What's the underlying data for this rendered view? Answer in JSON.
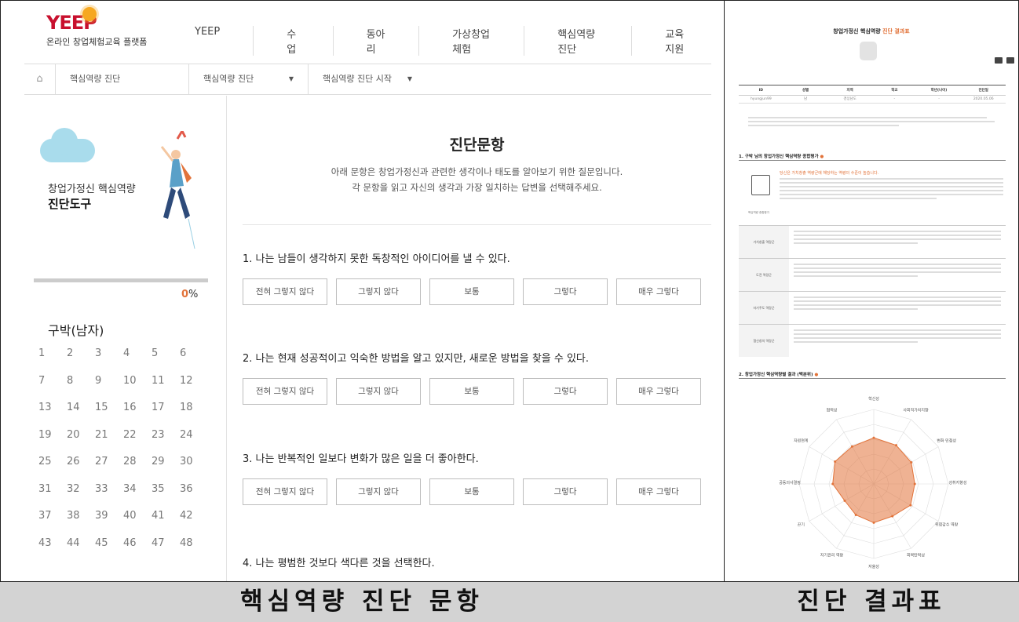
{
  "left": {
    "logo": {
      "word": "YEEP",
      "subtitle": "온라인 창업체험교육 플랫폼"
    },
    "nav": [
      "YEEP",
      "수업",
      "동아리",
      "가상창업체험",
      "핵심역량 진단",
      "교육지원"
    ],
    "subnav": {
      "home_icon": "home-icon",
      "items": [
        "핵심역량 진단",
        "핵심역량 진단",
        "핵심역량 진단 시작"
      ],
      "dropdown_glyph": "▼"
    },
    "sidebar": {
      "title_line1": "창업가정신 핵심역량",
      "title_line2": "진단도구",
      "progress_value": "0",
      "progress_unit": "%",
      "progress_fraction": 0,
      "stage": "구박(남자)",
      "numbers": [
        "1",
        "2",
        "3",
        "4",
        "5",
        "6",
        "7",
        "8",
        "9",
        "10",
        "11",
        "12",
        "13",
        "14",
        "15",
        "16",
        "17",
        "18",
        "19",
        "20",
        "21",
        "22",
        "23",
        "24",
        "25",
        "26",
        "27",
        "28",
        "29",
        "30",
        "31",
        "32",
        "33",
        "34",
        "35",
        "36",
        "37",
        "38",
        "39",
        "40",
        "41",
        "42",
        "43",
        "44",
        "45",
        "46",
        "47",
        "48"
      ]
    },
    "content": {
      "title": "진단문항",
      "desc_line1": "아래 문항은 창업가정신과 관련한 생각이나 태도를 알아보기 위한 질문입니다.",
      "desc_line2": "각 문항을 읽고 자신의 생각과 가장 일치하는 답변을 선택해주세요.",
      "options": [
        "전혀 그렇지 않다",
        "그렇지 않다",
        "보통",
        "그렇다",
        "매우 그렇다"
      ],
      "questions": [
        "1.   나는 남들이 생각하지 못한 독창적인 아이디어를 낼 수 있다.",
        "2.   나는 현재 성공적이고 익숙한 방법을 알고 있지만, 새로운 방법을 찾을 수 있다.",
        "3.   나는 반복적인 일보다 변화가 많은 일을 더 좋아한다.",
        "4.   나는 평범한 것보다 색다른 것을 선택한다."
      ]
    }
  },
  "right": {
    "title_prefix": "창업가정신 핵심역량",
    "title_accent": "진단 결과표",
    "table": {
      "headers": [
        "ID",
        "성별",
        "지역",
        "학교",
        "학년(나이)",
        "진단일"
      ],
      "row": [
        "hyungjun99",
        "남",
        "경상남도",
        "-",
        "-",
        "2020.05.06"
      ]
    },
    "section1_title": "1. 구박 님의 창업가정신 핵심역량 종합평가",
    "summary_headline": "당신은 가치창출 역량군에 해당하는 역량의 수준이 높습니다.",
    "doc_label": "핵심역량 종합평가",
    "categories": [
      "가치창출 역량군",
      "도전 역량군",
      "자기주도 역량군",
      "협신창의 역량군"
    ],
    "section2_title": "2. 창업가정신 핵심역량별 결과 (백분위)",
    "radar_labels": [
      "혁신성",
      "사회적가치지향",
      "변화 민첩성",
      "성취지향성",
      "위험감수 역량",
      "회복탄력성",
      "자율성",
      "자기관리 역량",
      "끈기",
      "공동의사결정",
      "자원연계",
      "협력성"
    ],
    "radar_values": [
      0.62,
      0.6,
      0.58,
      0.55,
      0.57,
      0.5,
      0.52,
      0.48,
      0.45,
      0.55,
      0.6,
      0.58
    ],
    "accent_color": "#e2733a"
  },
  "captions": {
    "left": "핵심역량 진단 문항",
    "right": "진단 결과표"
  }
}
